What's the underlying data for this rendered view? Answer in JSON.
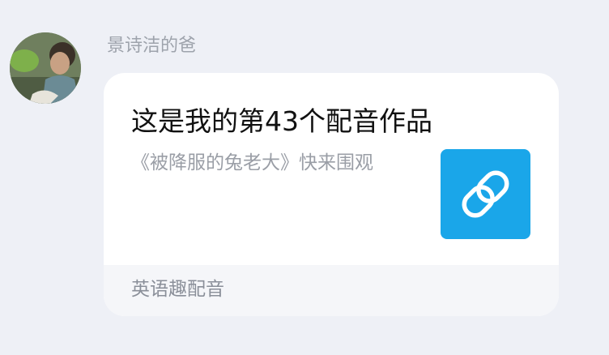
{
  "message": {
    "sender_name": "景诗洁的爸",
    "avatar_icon": "user-avatar-photo"
  },
  "card": {
    "title": "这是我的第43个配音作品",
    "description": "《被降服的兔老大》快来围观",
    "thumbnail_icon": "link-chain-icon",
    "thumbnail_color": "#1aa6e9",
    "source_app": "英语趣配音"
  }
}
